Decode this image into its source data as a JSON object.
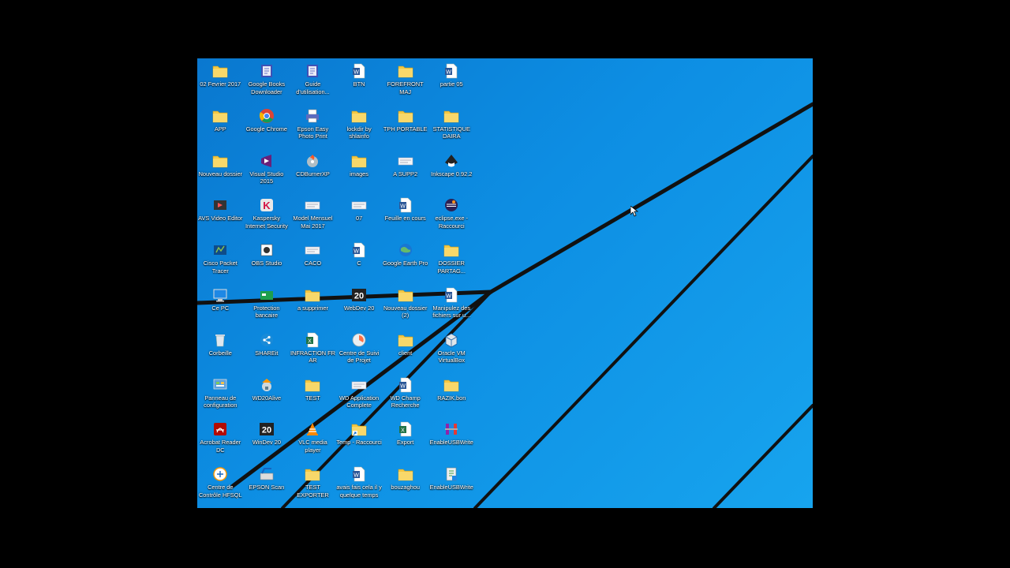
{
  "desktop": {
    "colors": {
      "background": "#0d8ee3",
      "beam": "#111111",
      "folder": "#f3c843"
    },
    "columns": [
      [
        {
          "label": "02 Fevrier 2017",
          "icon": "folder-icon"
        },
        {
          "label": "APP",
          "icon": "folder-icon"
        },
        {
          "label": "Nouveau dossier",
          "icon": "folder-icon"
        },
        {
          "label": "AVS Video Editor",
          "icon": "avs-video-editor-icon"
        },
        {
          "label": "Cisco Packet Tracer",
          "icon": "cisco-packet-tracer-icon"
        },
        {
          "label": "Ce PC",
          "icon": "computer-icon"
        },
        {
          "label": "Corbeille",
          "icon": "recycle-bin-icon"
        },
        {
          "label": "Panneau de configuration",
          "icon": "control-panel-icon"
        },
        {
          "label": "Acrobat Reader DC",
          "icon": "acrobat-reader-icon"
        },
        {
          "label": "Centre de Contrôle HFSQL",
          "icon": "hfsql-icon"
        }
      ],
      [
        {
          "label": "Google Books Downloader",
          "icon": "books-downloader-icon"
        },
        {
          "label": "Google Chrome",
          "icon": "chrome-icon"
        },
        {
          "label": "Visual Studio 2015",
          "icon": "visual-studio-icon"
        },
        {
          "label": "Kaspersky Internet Security",
          "icon": "kaspersky-icon"
        },
        {
          "label": "OBS Studio",
          "icon": "obs-icon"
        },
        {
          "label": "Protection bancaire",
          "icon": "bank-protection-icon"
        },
        {
          "label": "SHAREit",
          "icon": "shareit-icon"
        },
        {
          "label": "WD20Alive",
          "icon": "wdalive-icon"
        },
        {
          "label": "WinDev 20",
          "icon": "windev-icon"
        },
        {
          "label": "EPSON Scan",
          "icon": "scanner-icon"
        }
      ],
      [
        {
          "label": "Guide d'utilisation...",
          "icon": "guide-icon"
        },
        {
          "label": "Epson Easy Photo Print",
          "icon": "printer-icon"
        },
        {
          "label": "CDBurnerXP",
          "icon": "cdburner-icon"
        },
        {
          "label": "Model Mensuel Mai 2017",
          "icon": "document-icon"
        },
        {
          "label": "CACO",
          "icon": "document-icon"
        },
        {
          "label": "a supprimer",
          "icon": "folder-icon"
        },
        {
          "label": "INFRACTION FR AR",
          "icon": "excel-icon"
        },
        {
          "label": "TEST",
          "icon": "folder-icon"
        },
        {
          "label": "VLC media player",
          "icon": "vlc-icon"
        },
        {
          "label": "TEST EXPORTER",
          "icon": "folder-icon"
        }
      ],
      [
        {
          "label": "BTN",
          "icon": "word-icon"
        },
        {
          "label": "lockdir by shlainfo",
          "icon": "folder-icon"
        },
        {
          "label": "images",
          "icon": "folder-icon"
        },
        {
          "label": "07",
          "icon": "document-icon"
        },
        {
          "label": "C",
          "icon": "word-icon"
        },
        {
          "label": "WebDev 20",
          "icon": "webdev-icon"
        },
        {
          "label": "Centre de Suivi de Projet",
          "icon": "project-center-icon"
        },
        {
          "label": "WD Application Complete",
          "icon": "document-icon"
        },
        {
          "label": "Temp - Raccourci",
          "icon": "folder-shortcut-icon"
        },
        {
          "label": "avais fais cela il y quelque temps",
          "icon": "word-icon"
        }
      ],
      [
        {
          "label": "FOREFRONT MAJ",
          "icon": "folder-icon"
        },
        {
          "label": "TPH PORTABLE",
          "icon": "folder-icon"
        },
        {
          "label": "A SUPP2",
          "icon": "document-icon"
        },
        {
          "label": "Feuille en cours",
          "icon": "word-icon"
        },
        {
          "label": "Google Earth Pro",
          "icon": "google-earth-icon"
        },
        {
          "label": "Nouveau dossier (2)",
          "icon": "folder-icon"
        },
        {
          "label": "client",
          "icon": "folder-icon"
        },
        {
          "label": "WD Champ Recherche",
          "icon": "word-icon"
        },
        {
          "label": "Export",
          "icon": "excel-icon"
        },
        {
          "label": "bouzaghou",
          "icon": "folder-icon"
        }
      ],
      [
        {
          "label": "partie 05",
          "icon": "word-icon"
        },
        {
          "label": "STATISTIQUE DAIRA",
          "icon": "folder-icon"
        },
        {
          "label": "Inkscape 0.92.2",
          "icon": "inkscape-icon"
        },
        {
          "label": "eclipse.exe - Raccourci",
          "icon": "eclipse-icon"
        },
        {
          "label": "DOSSIER PARTAG...",
          "icon": "folder-icon"
        },
        {
          "label": "Manipulez des fichiers sur u...",
          "icon": "word-icon"
        },
        {
          "label": "Oracle VM VirtualBox",
          "icon": "virtualbox-icon"
        },
        {
          "label": "RAZIK.bon",
          "icon": "folder-icon"
        },
        {
          "label": "EnableUSBWrite",
          "icon": "rar-icon"
        },
        {
          "label": "EnableUSBWrite",
          "icon": "usb-tool-icon"
        }
      ]
    ]
  }
}
